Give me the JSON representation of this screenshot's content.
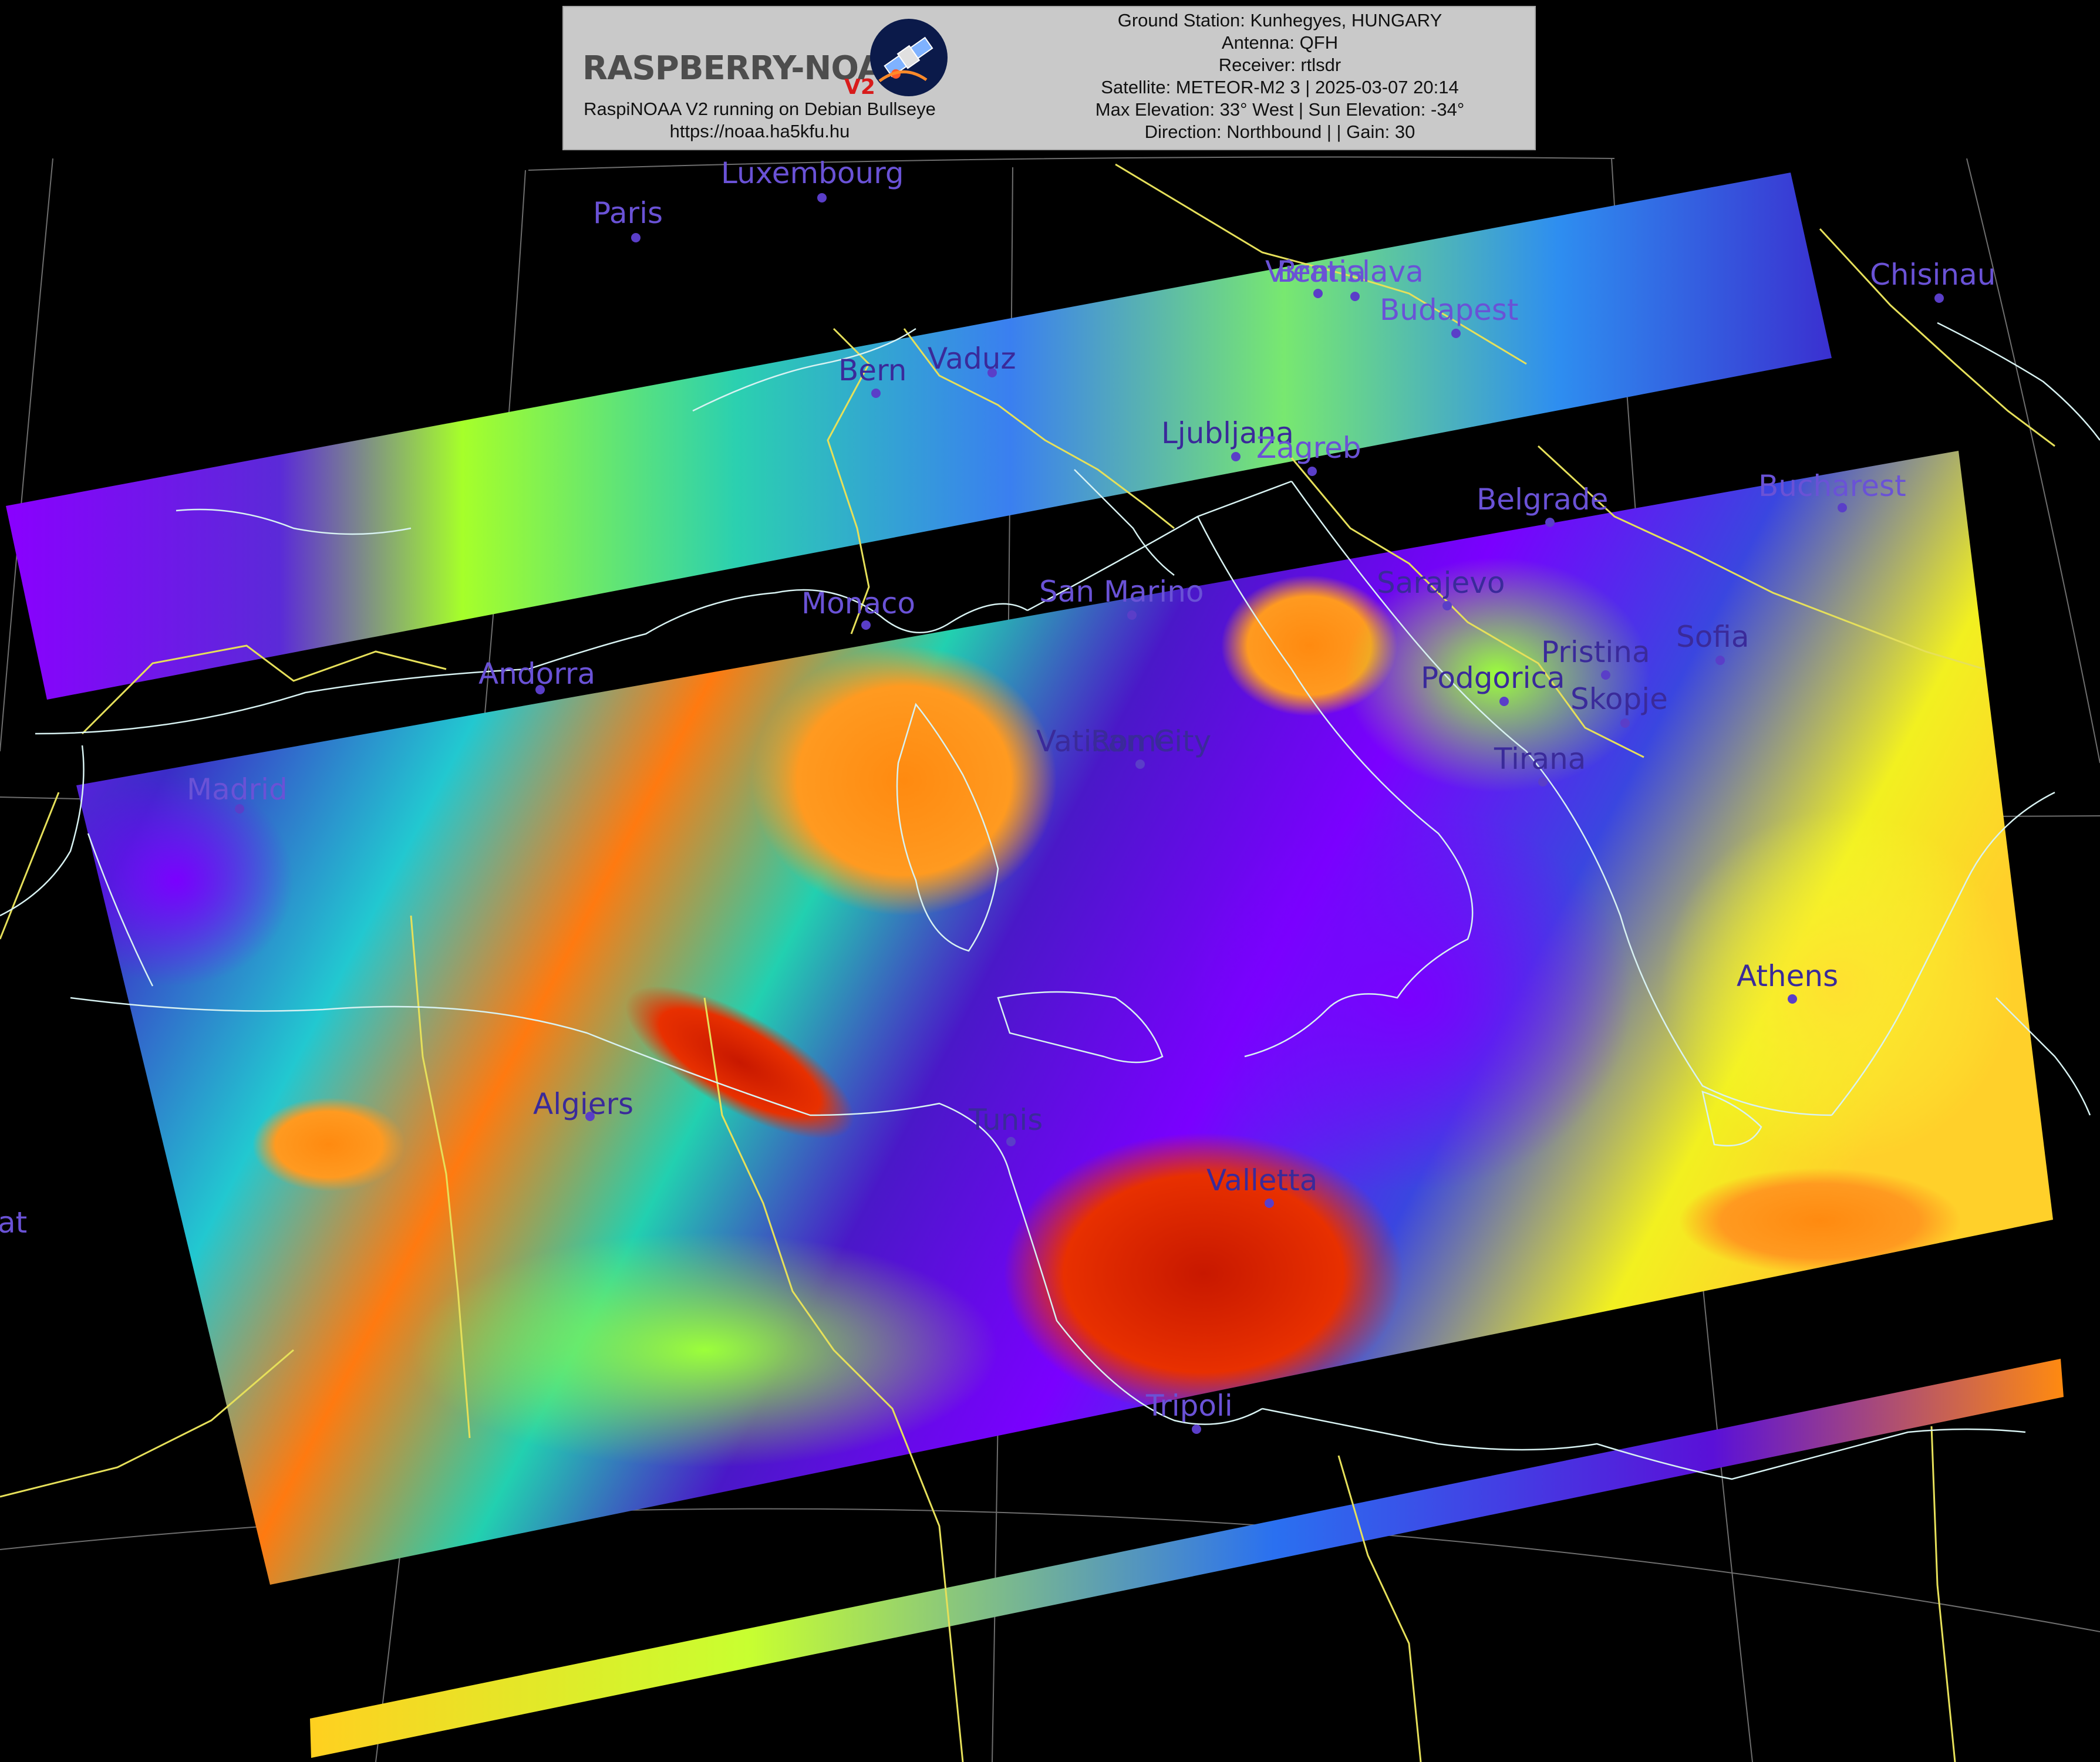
{
  "header": {
    "logo_text": "RASPBERRY-NOAA",
    "logo_version": "V2",
    "software_line": "RaspiNOAA V2 running on Debian Bullseye",
    "url_line": "https://noaa.ha5kfu.hu",
    "ground_station": "Ground Station: Kunhegyes, HUNGARY",
    "antenna": "Antenna: QFH",
    "receiver": "Receiver: rtlsdr",
    "satellite": "Satellite: METEOR-M2 3 | 2025-03-07 20:14",
    "elevation": "Max Elevation: 33° West | Sun Elevation: -34°",
    "direction": "Direction: Northbound | | Gain: 30"
  },
  "cities": [
    {
      "id": "luxembourg",
      "name": "Luxembourg"
    },
    {
      "id": "paris",
      "name": "Paris"
    },
    {
      "id": "vienna",
      "name": "Vienna"
    },
    {
      "id": "bratislava",
      "name": "Bratislava"
    },
    {
      "id": "budapest",
      "name": "Budapest"
    },
    {
      "id": "chisinau",
      "name": "Chisinau"
    },
    {
      "id": "bern",
      "name": "Bern"
    },
    {
      "id": "vaduz",
      "name": "Vaduz"
    },
    {
      "id": "ljubljana",
      "name": "Ljubljana"
    },
    {
      "id": "zagreb",
      "name": "Zagreb"
    },
    {
      "id": "belgrade",
      "name": "Belgrade"
    },
    {
      "id": "bucharest",
      "name": "Bucharest"
    },
    {
      "id": "monaco",
      "name": "Monaco"
    },
    {
      "id": "san-marino",
      "name": "San Marino"
    },
    {
      "id": "sarajevo",
      "name": "Sarajevo"
    },
    {
      "id": "andorra",
      "name": "Andorra"
    },
    {
      "id": "pristina",
      "name": "Pristina"
    },
    {
      "id": "sofia",
      "name": "Sofia"
    },
    {
      "id": "podgorica",
      "name": "Podgorica"
    },
    {
      "id": "skopje",
      "name": "Skopje"
    },
    {
      "id": "vatican-city",
      "name": "Vatican City"
    },
    {
      "id": "rome",
      "name": "Rome"
    },
    {
      "id": "tirana",
      "name": "Tirana"
    },
    {
      "id": "madrid",
      "name": "Madrid"
    },
    {
      "id": "athens",
      "name": "Athens"
    },
    {
      "id": "algiers",
      "name": "Algiers"
    },
    {
      "id": "tunis",
      "name": "Tunis"
    },
    {
      "id": "valletta",
      "name": "Valletta"
    },
    {
      "id": "tripoli",
      "name": "Tripoli"
    },
    {
      "id": "rabat",
      "name": "Rabat"
    }
  ],
  "colors": {
    "background": "#000000",
    "city_label": "#6a52d6",
    "country_border": "#e6e05a",
    "coastline": "#d8f2f2",
    "graticule": "#9a9a9a",
    "scale_low": "#8a00ff",
    "scale_mid": "#2bd0b0",
    "scale_high": "#e01a00"
  }
}
